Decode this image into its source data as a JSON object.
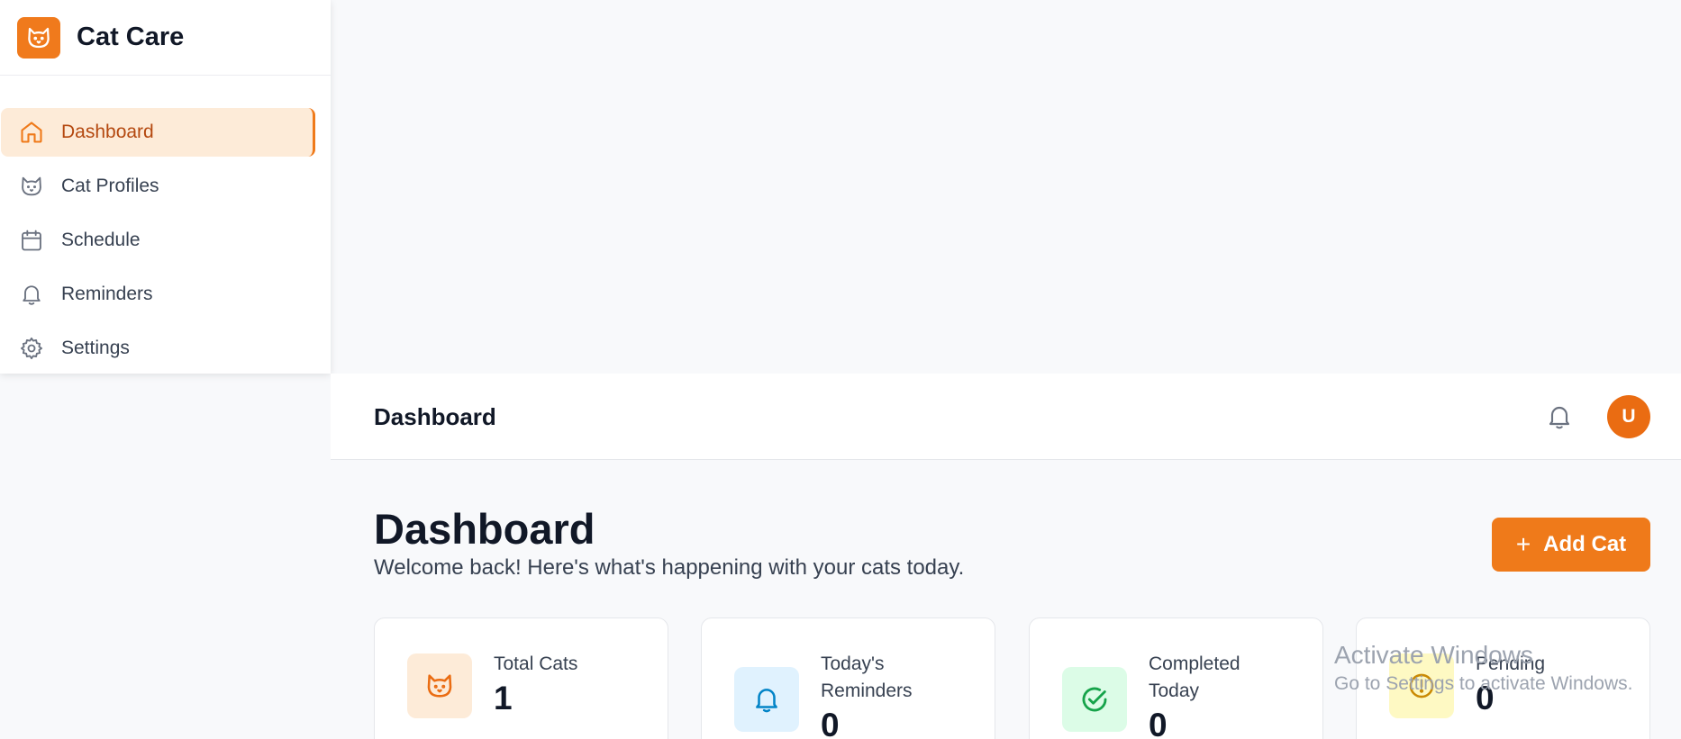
{
  "brand": {
    "name": "Cat Care",
    "icon": "cat-face-icon"
  },
  "sidebar": {
    "items": [
      {
        "label": "Dashboard",
        "icon": "home-icon",
        "active": true
      },
      {
        "label": "Cat Profiles",
        "icon": "cat-face-icon",
        "active": false
      },
      {
        "label": "Schedule",
        "icon": "calendar-icon",
        "active": false
      },
      {
        "label": "Reminders",
        "icon": "bell-icon",
        "active": false
      },
      {
        "label": "Settings",
        "icon": "gear-icon",
        "active": false
      }
    ]
  },
  "header": {
    "title": "Dashboard",
    "avatar_initial": "U"
  },
  "main": {
    "title": "Dashboard",
    "subtitle": "Welcome back! Here's what's happening with your cats today.",
    "add_button_label": "Add Cat",
    "stats": [
      {
        "label": "Total Cats",
        "value": "1",
        "icon": "cat-face-icon"
      },
      {
        "label": "Today's Reminders",
        "value": "0",
        "icon": "bell-icon"
      },
      {
        "label": "Completed Today",
        "value": "0",
        "icon": "check-circle-icon"
      },
      {
        "label": "Pending",
        "value": "0",
        "icon": "alert-circle-icon"
      }
    ]
  },
  "watermark": {
    "title": "Activate Windows",
    "subtitle": "Go to Settings to activate Windows."
  },
  "colors": {
    "accent": "#ef7a1a",
    "active_bg": "#fdebd8",
    "active_text": "#b4480f",
    "background": "#f8f9fb"
  }
}
